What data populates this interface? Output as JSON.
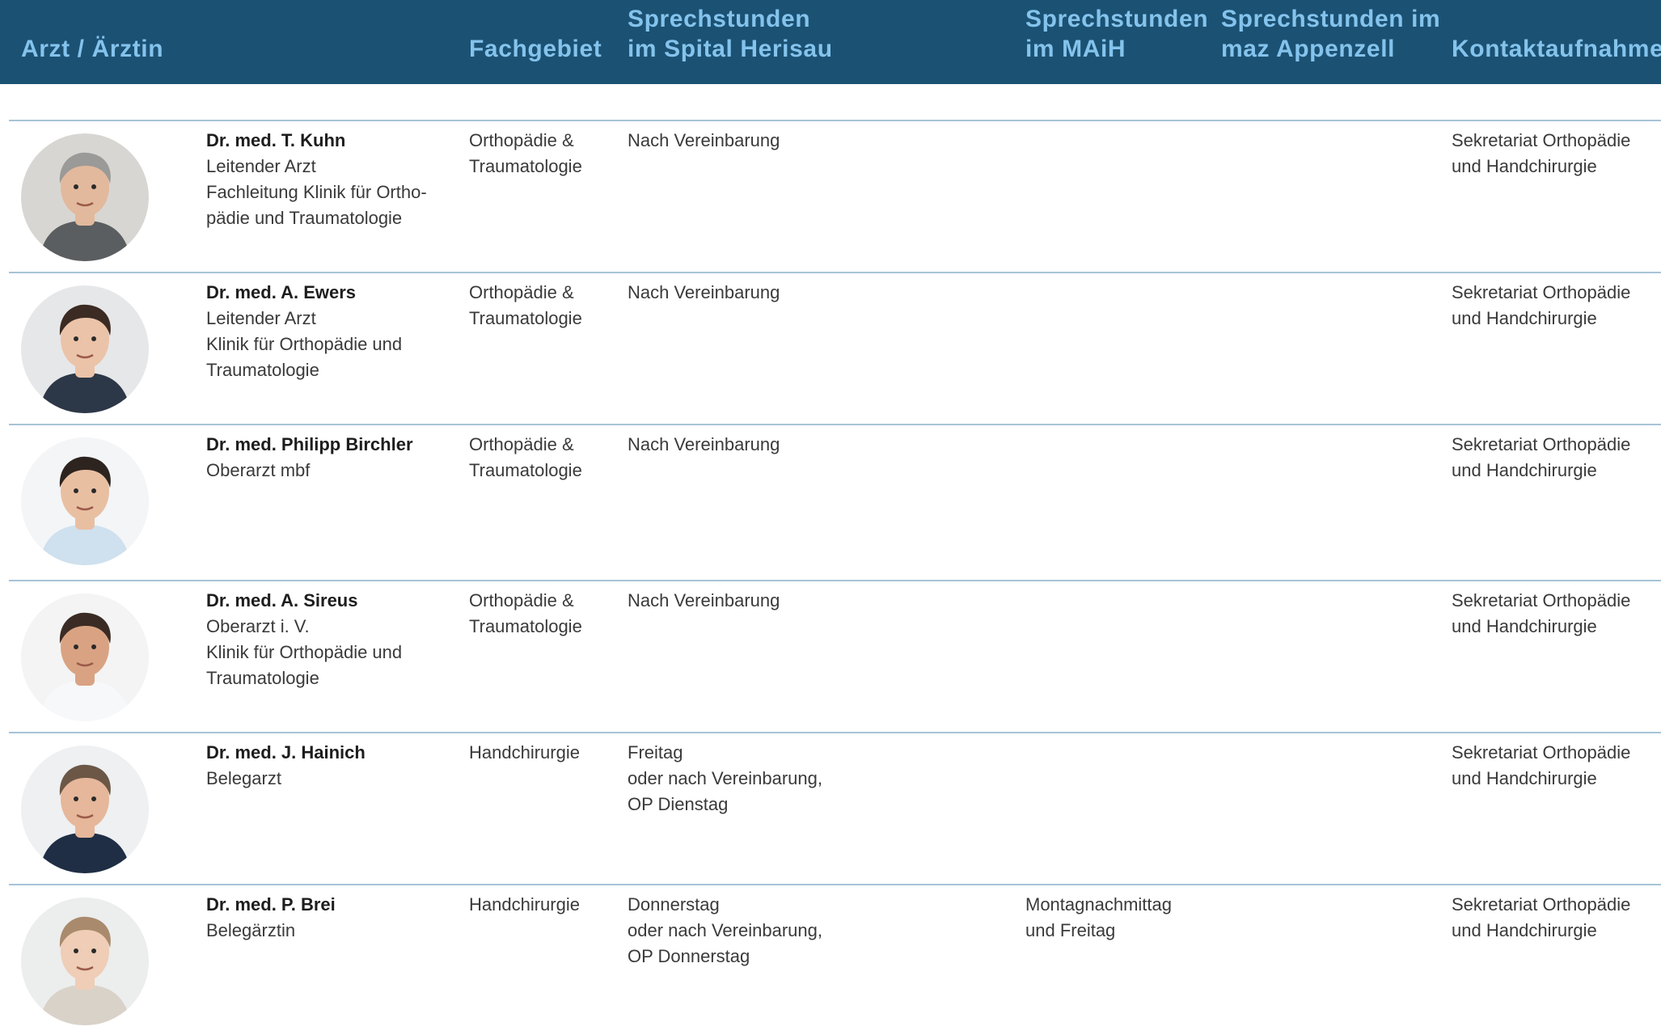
{
  "header": {
    "col_arzt": "Arzt / Ärztin",
    "col_fachgebiet": "Fachgebiet",
    "col_herisau": "Sprechstunden\nim Spital Herisau",
    "col_maih": "Sprechstunden\nim MAiH",
    "col_maz": "Sprechstunden im\nmaz Appenzell",
    "col_kontakt": "Kontaktaufnahme"
  },
  "doctors": [
    {
      "name": "Dr. med. T. Kuhn",
      "roles": "Leitender Arzt\nFachleitung Klinik für Ortho-\npädie und Traumatologie",
      "fachgebiet": "Orthopädie &\nTraumatologie",
      "herisau": "Nach Vereinbarung",
      "maih": "",
      "maz": "",
      "kontakt": "Sekretariat Orthopädie\nund Handchirurgie",
      "avatar_bg": "#d8d6d2",
      "avatar_hair": "#9a9a98",
      "avatar_skin": "#e2b99c",
      "avatar_clothes": "#5b5e60"
    },
    {
      "name": "Dr. med. A. Ewers",
      "roles": "Leitender Arzt\nKlinik für Orthopädie und\nTraumatologie",
      "fachgebiet": "Orthopädie &\nTraumatologie",
      "herisau": "Nach Vereinbarung",
      "maih": "",
      "maz": "",
      "kontakt": "Sekretariat Orthopädie\nund Handchirurgie",
      "avatar_bg": "#e6e7e9",
      "avatar_hair": "#3b2b22",
      "avatar_skin": "#ebc3a8",
      "avatar_clothes": "#2c3747"
    },
    {
      "name": "Dr. med. Philipp Birchler",
      "roles": "Oberarzt mbf",
      "fachgebiet": "Orthopädie &\nTraumatologie",
      "herisau": "Nach Vereinbarung",
      "maih": "",
      "maz": "",
      "kontakt": "Sekretariat Orthopädie\nund Handchirurgie",
      "avatar_bg": "#f3f5f7",
      "avatar_hair": "#2d241f",
      "avatar_skin": "#e9bfa2",
      "avatar_clothes": "#cfe0ee"
    },
    {
      "name": "Dr. med. A. Sireus",
      "roles": "Oberarzt i. V.\nKlinik für Orthopädie und\nTraumatologie",
      "fachgebiet": "Orthopädie &\nTraumatologie",
      "herisau": "Nach Vereinbarung",
      "maih": "",
      "maz": "",
      "kontakt": "Sekretariat Orthopädie\nund Handchirurgie",
      "avatar_bg": "#f4f4f4",
      "avatar_hair": "#3a2c24",
      "avatar_skin": "#d9a383",
      "avatar_clothes": "#f7f8fa"
    },
    {
      "name": "Dr. med. J. Hainich",
      "roles": "Belegarzt",
      "fachgebiet": "Handchirurgie",
      "herisau": "Freitag\noder nach Vereinbarung,\nOP Dienstag",
      "maih": "",
      "maz": "",
      "kontakt": "Sekretariat Orthopädie\nund Handchirurgie",
      "avatar_bg": "#eef0f2",
      "avatar_hair": "#6c5746",
      "avatar_skin": "#e6b79a",
      "avatar_clothes": "#1f2e44"
    },
    {
      "name": "Dr. med. P. Brei",
      "roles": "Belegärztin",
      "fachgebiet": "Handchirurgie",
      "herisau": "Donnerstag\noder nach Vereinbarung,\nOP Donnerstag",
      "maih": "Montagnachmittag\nund Freitag",
      "maz": "",
      "kontakt": "Sekretariat Orthopädie\nund Handchirurgie",
      "avatar_bg": "#eceded",
      "avatar_hair": "#a98a6c",
      "avatar_skin": "#efcdb6",
      "avatar_clothes": "#d9d2c8"
    }
  ]
}
